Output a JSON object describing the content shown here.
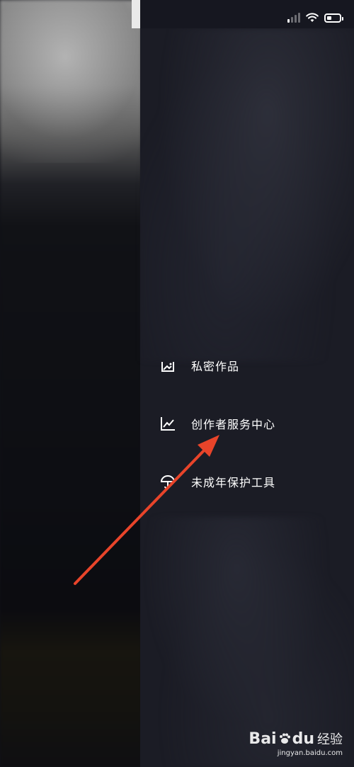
{
  "menu": {
    "items": [
      {
        "label": "私密作品",
        "icon": "image-icon"
      },
      {
        "label": "创作者服务中心",
        "icon": "chart-line-icon"
      },
      {
        "label": "未成年保护工具",
        "icon": "umbrella-icon"
      }
    ]
  },
  "status_bar": {
    "icons": [
      "signal-icon",
      "wifi-icon",
      "battery-icon"
    ],
    "signal_bars_active": 1,
    "battery_level": 0.2
  },
  "annotation": {
    "type": "arrow",
    "color": "#e8442a",
    "target": "创作者服务中心"
  },
  "watermark": {
    "logo_text": "Bai",
    "logo_text2": "du",
    "cn": "经验",
    "url": "jingyan.baidu.com"
  },
  "colors": {
    "drawer_bg": "#1b1c25",
    "text": "#ffffff",
    "arrow": "#e8442a"
  }
}
